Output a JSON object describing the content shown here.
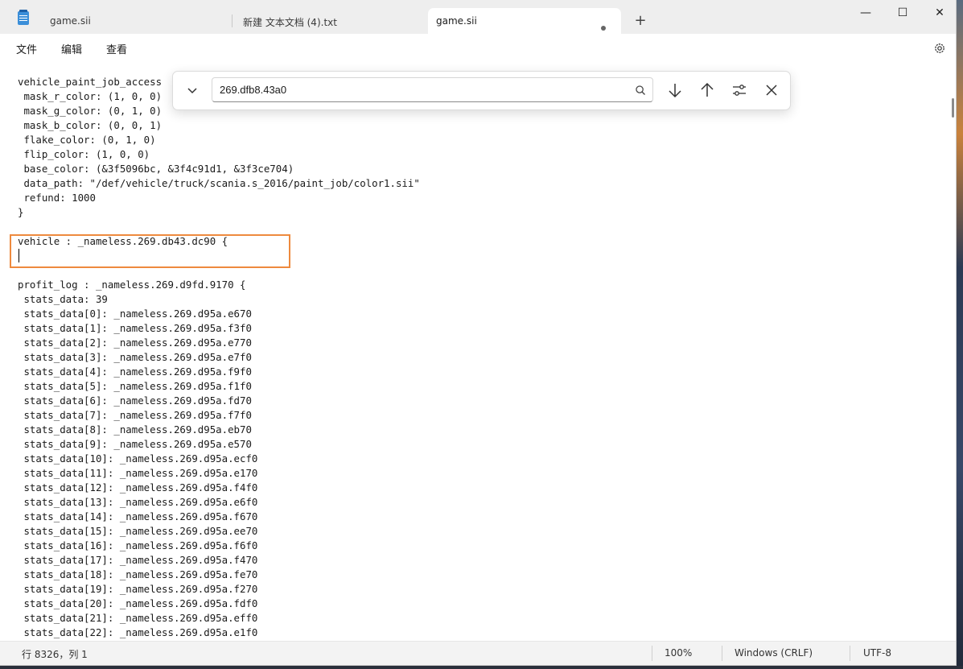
{
  "tabs": [
    {
      "label": "game.sii",
      "active": false
    },
    {
      "label": "新建 文本文档 (4).txt",
      "active": false
    },
    {
      "label": "game.sii",
      "active": true,
      "modified": true
    }
  ],
  "window_controls": {
    "minimize": "—",
    "maximize": "☐",
    "close": "✕"
  },
  "menu": {
    "file": "文件",
    "edit": "编辑",
    "view": "查看"
  },
  "find": {
    "query": "269.dfb8.43a0"
  },
  "editor_lines": [
    "vehicle_paint_job_access",
    " mask_r_color: (1, 0, 0)",
    " mask_g_color: (0, 1, 0)",
    " mask_b_color: (0, 0, 1)",
    " flake_color: (0, 1, 0)",
    " flip_color: (1, 0, 0)",
    " base_color: (&3f5096bc, &3f4c91d1, &3f3ce704)",
    " data_path: \"/def/vehicle/truck/scania.s_2016/paint_job/color1.sii\"",
    " refund: 1000",
    "}",
    "",
    "vehicle : _nameless.269.db43.dc90 {",
    "",
    "",
    "profit_log : _nameless.269.d9fd.9170 {",
    " stats_data: 39",
    " stats_data[0]: _nameless.269.d95a.e670",
    " stats_data[1]: _nameless.269.d95a.f3f0",
    " stats_data[2]: _nameless.269.d95a.e770",
    " stats_data[3]: _nameless.269.d95a.e7f0",
    " stats_data[4]: _nameless.269.d95a.f9f0",
    " stats_data[5]: _nameless.269.d95a.f1f0",
    " stats_data[6]: _nameless.269.d95a.fd70",
    " stats_data[7]: _nameless.269.d95a.f7f0",
    " stats_data[8]: _nameless.269.d95a.eb70",
    " stats_data[9]: _nameless.269.d95a.e570",
    " stats_data[10]: _nameless.269.d95a.ecf0",
    " stats_data[11]: _nameless.269.d95a.e170",
    " stats_data[12]: _nameless.269.d95a.f4f0",
    " stats_data[13]: _nameless.269.d95a.e6f0",
    " stats_data[14]: _nameless.269.d95a.f670",
    " stats_data[15]: _nameless.269.d95a.ee70",
    " stats_data[16]: _nameless.269.d95a.f6f0",
    " stats_data[17]: _nameless.269.d95a.f470",
    " stats_data[18]: _nameless.269.d95a.fe70",
    " stats_data[19]: _nameless.269.d95a.f270",
    " stats_data[20]: _nameless.269.d95a.fdf0",
    " stats_data[21]: _nameless.269.d95a.eff0",
    " stats_data[22]: _nameless.269.d95a.e1f0"
  ],
  "status": {
    "position": "行 8326，列 1",
    "zoom": "100%",
    "line_ending": "Windows (CRLF)",
    "encoding": "UTF-8"
  },
  "colors": {
    "highlight_box": "#ee8a3e",
    "accent": "#3b8fd9"
  }
}
